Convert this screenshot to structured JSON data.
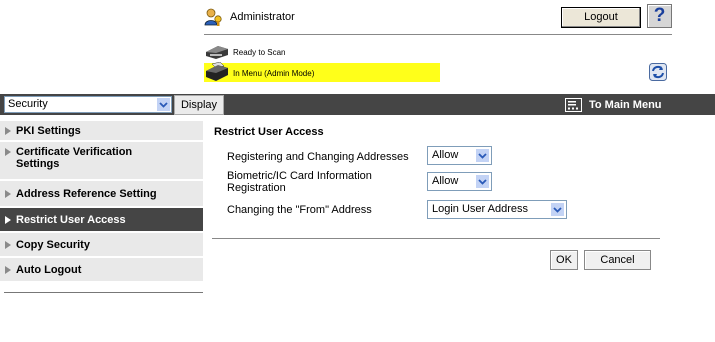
{
  "header": {
    "user_label": "Administrator",
    "logout_label": "Logout",
    "help_label": "?"
  },
  "status": {
    "scan_status": "Ready to Scan",
    "mode_status": "In Menu (Admin Mode)",
    "mode_highlight_color": "#ffff1a"
  },
  "toolbar": {
    "category_value": "Security",
    "display_label": "Display",
    "main_menu_label": "To Main Menu"
  },
  "sidebar": {
    "items": [
      {
        "label": "PKI Settings"
      },
      {
        "label": "Certificate Verification Settings"
      },
      {
        "label": "Address Reference Setting"
      },
      {
        "label": "Restrict User Access"
      },
      {
        "label": "Copy Security"
      },
      {
        "label": "Auto Logout"
      }
    ],
    "active_index": 3
  },
  "main": {
    "title": "Restrict User Access",
    "rows": [
      {
        "label": "Registering and Changing Addresses",
        "value": "Allow"
      },
      {
        "label": "Biometric/IC Card Information Registration",
        "value": "Allow"
      },
      {
        "label": "Changing the \"From\" Address",
        "value": "Login User Address"
      }
    ],
    "ok_label": "OK",
    "cancel_label": "Cancel"
  },
  "icons": {
    "admin": "admin-user-icon",
    "scanner": "scanner-icon",
    "printer": "printer-icon",
    "refresh": "refresh-icon",
    "main_menu": "main-menu-icon",
    "dropdown": "chevron-down-icon"
  },
  "colors": {
    "dark_bar": "#454545",
    "sidebar_bg": "#e9e9e9",
    "dropdown_arrow": "#2a5ab8"
  }
}
